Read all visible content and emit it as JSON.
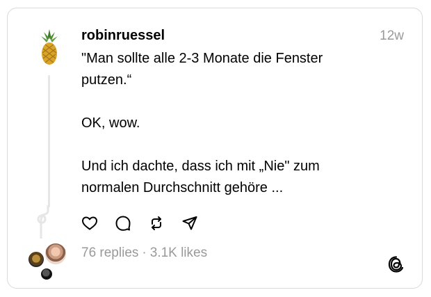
{
  "post": {
    "username": "robinruessel",
    "timestamp": "12w",
    "lines": [
      "\"Man sollte alle 2-3 Monate die Fenster",
      "putzen.“",
      "",
      "OK, wow.",
      "",
      "Und ich dachte, dass ich mit „Nie\" zum",
      "normalen Durchschnitt gehöre ..."
    ]
  },
  "actions": {
    "icons": [
      "heart-icon",
      "comment-icon",
      "repost-icon",
      "share-icon"
    ]
  },
  "stats": {
    "replies": "76 replies",
    "separator": "·",
    "likes": "3.1K likes"
  },
  "brand": {
    "logo": "threads-logo-icon",
    "text_color": "#000000",
    "muted_color": "#999999",
    "border_color": "#d9d9d9"
  }
}
